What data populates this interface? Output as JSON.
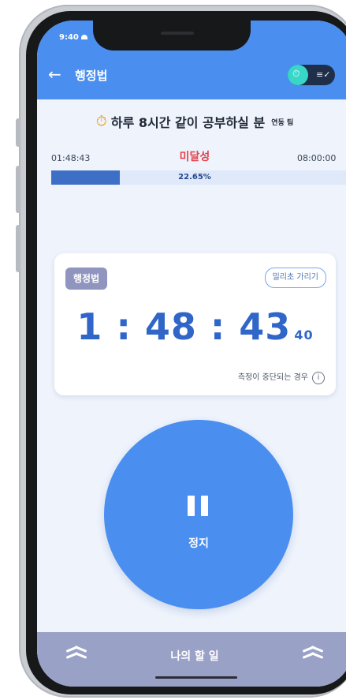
{
  "status_bar": {
    "time": "9:40"
  },
  "header": {
    "title": "행정법",
    "back_label": "←",
    "toggle_icon": "stopwatch-icon",
    "toggle_right": "memo-icon"
  },
  "goal": {
    "text": "하루 8시간 같이 공부하실 분",
    "user": "연동 팀"
  },
  "progress": {
    "elapsed": "01:48:43",
    "status": "미달성",
    "target": "08:00:00",
    "percent_text": "22.65%",
    "percent": 22.65
  },
  "timer": {
    "subject": "행정법",
    "ms_toggle": "밀리초 가리기",
    "time": "1 : 48 : 43",
    "ms": "40",
    "interrupt_note": "측정이 중단되는 경우",
    "info": "i"
  },
  "stop_button": {
    "label": "정지"
  },
  "bottom_bar": {
    "label": "나의 할 일"
  },
  "colors": {
    "primary": "#4a8ef0",
    "danger": "#e5424b",
    "progress_fill": "#3d6fc6",
    "chip": "#8f95bf"
  }
}
